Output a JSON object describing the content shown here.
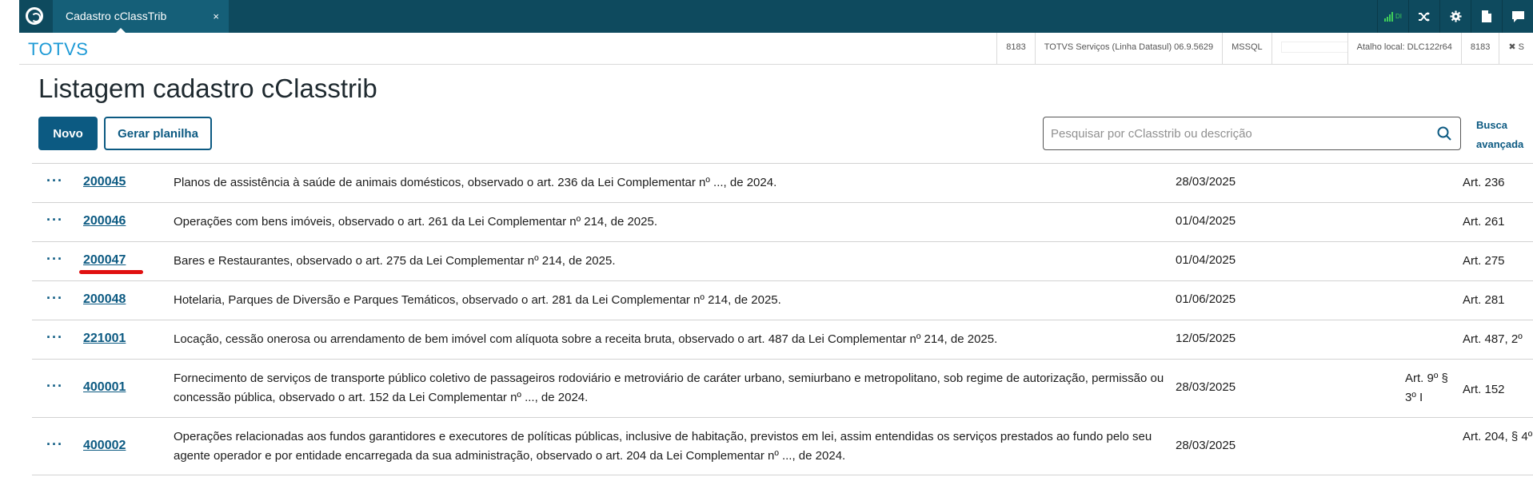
{
  "topbar": {
    "tab_title": "Cadastro cClassTrib",
    "tab_close": "×",
    "signal_text": "DI",
    "icons": [
      "logo-icon",
      "signal-icon",
      "shuffle-icon",
      "gear-icon",
      "document-icon",
      "chat-icon"
    ]
  },
  "header": {
    "brand": "TOTVS",
    "info": {
      "code1": "8183",
      "product": "TOTVS Serviços (Linha Datasul) 06.9.5629",
      "db": "MSSQL",
      "shortcut": "Atalho local: DLC122r64",
      "code2": "8183",
      "exit": "✖ S"
    }
  },
  "page": {
    "title": "Listagem cadastro cClasstrib",
    "btn_new": "Novo",
    "btn_sheet": "Gerar planilha",
    "search_placeholder": "Pesquisar por cClasstrib ou descrição",
    "advanced_search_line1": "Busca",
    "advanced_search_line2": "avançada"
  },
  "rows": [
    {
      "actions": "···",
      "code": "200045",
      "desc": "Planos de assistência à saúde de animais domésticos, observado o art. 236 da Lei Complementar nº ..., de 2024.",
      "date": "28/03/2025",
      "col6": "",
      "col7": "Art. 236"
    },
    {
      "actions": "···",
      "code": "200046",
      "desc": "Operações com bens imóveis, observado o art. 261 da Lei Complementar nº 214, de 2025.",
      "date": "01/04/2025",
      "col6": "",
      "col7": "Art. 261"
    },
    {
      "actions": "···",
      "code": "200047",
      "desc": "Bares e Restaurantes, observado o art. 275 da Lei Complementar nº 214, de 2025.",
      "date": "01/04/2025",
      "col6": "",
      "col7": "Art. 275"
    },
    {
      "actions": "···",
      "code": "200048",
      "desc": "Hotelaria, Parques de Diversão e Parques Temáticos, observado o art. 281 da Lei Complementar nº 214, de 2025.",
      "date": "01/06/2025",
      "col6": "",
      "col7": "Art. 281"
    },
    {
      "actions": "···",
      "code": "221001",
      "desc": "Locação, cessão onerosa ou arrendamento de bem imóvel com alíquota sobre a receita bruta, observado o art. 487 da Lei Complementar nº 214, de 2025.",
      "date": "12/05/2025",
      "col6": "",
      "col7": "Art. 487, 2º"
    },
    {
      "actions": "···",
      "code": "400001",
      "desc": "Fornecimento de serviços de transporte público coletivo de passageiros rodoviário e metroviário de caráter urbano, semiurbano e metropolitano, sob regime de autorização, permissão ou concessão pública, observado o art. 152 da Lei Complementar nº ..., de 2024.",
      "date": "28/03/2025",
      "col6": "Art. 9º § 3º I",
      "col7": "Art. 152"
    },
    {
      "actions": "···",
      "code": "400002",
      "desc": "Operações relacionadas aos fundos garantidores e executores de políticas públicas, inclusive de habitação, previstos em lei, assim entendidas os serviços prestados ao fundo pelo seu agente operador e por entidade encarregada da sua administração, observado o art. 204 da Lei Complementar nº ..., de 2024.",
      "date": "28/03/2025",
      "col6": "",
      "col7": "Art. 204, § 4º"
    }
  ],
  "colors": {
    "topbar": "#0e4a5e",
    "tab": "#155f78",
    "accent": "#0c5a82",
    "brand": "#1d9ad6",
    "annotation": "#e01010"
  }
}
